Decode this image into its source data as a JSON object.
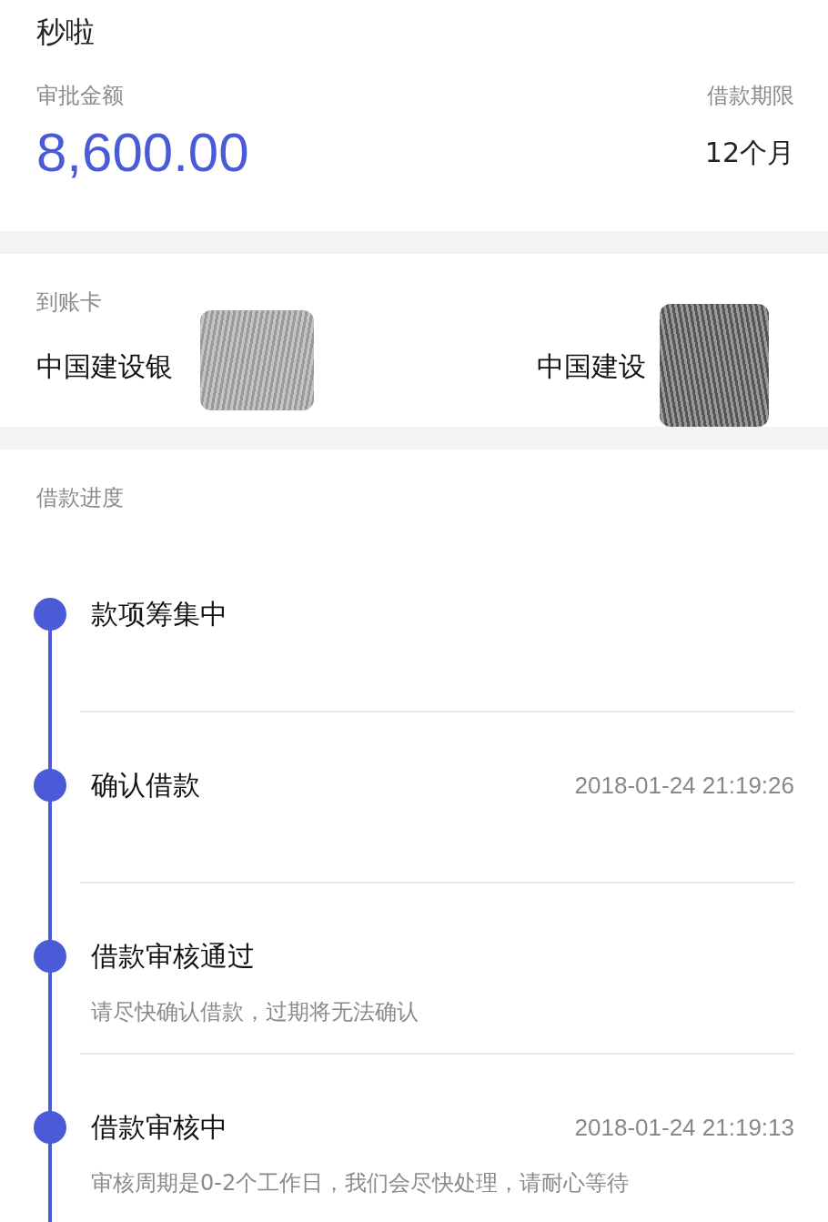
{
  "header": {
    "title": "秒啦"
  },
  "summary": {
    "amount_label": "审批金额",
    "amount": "8,600.00",
    "term_label": "借款期限",
    "term": "12个月"
  },
  "card": {
    "label": "到账卡",
    "bank_left": "中国建设银",
    "bank_right": "中国建设"
  },
  "progress": {
    "label": "借款进度",
    "steps": [
      {
        "title": "款项筹集中"
      },
      {
        "title": "确认借款",
        "time": "2018-01-24 21:19:26"
      },
      {
        "title": "借款审核通过",
        "note": "请尽快确认借款，过期将无法确认"
      },
      {
        "title": "借款审核中",
        "time": "2018-01-24 21:19:13",
        "note": "审核周期是0-2个工作日，我们会尽快处理，请耐心等待"
      }
    ]
  }
}
